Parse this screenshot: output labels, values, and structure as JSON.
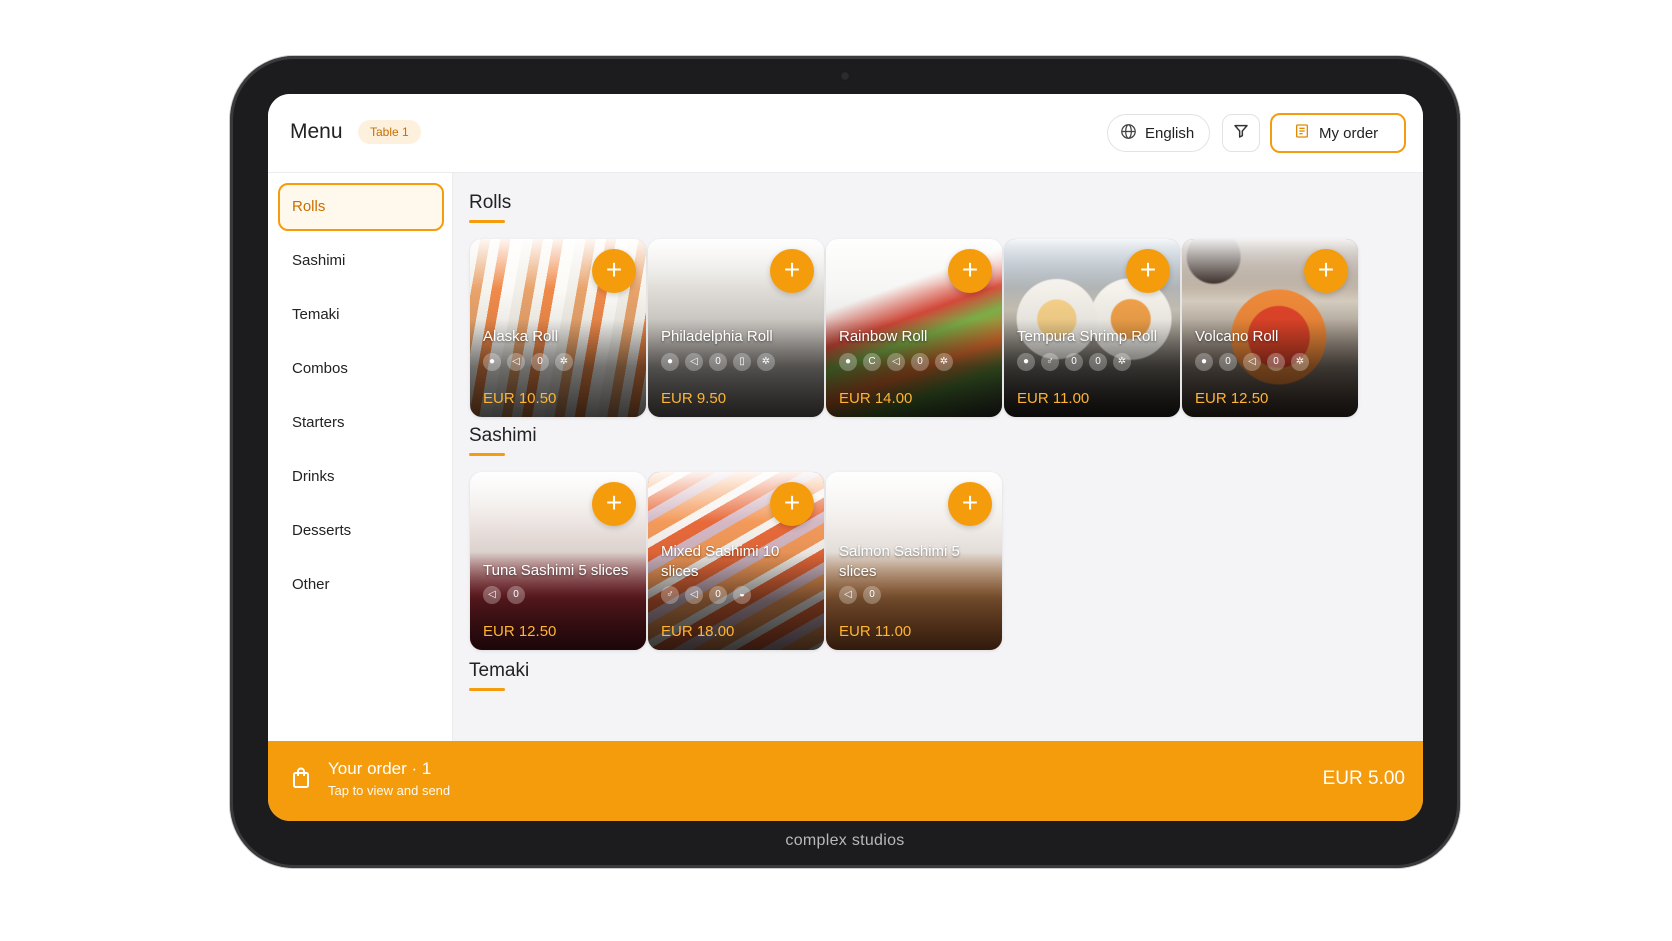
{
  "header": {
    "title": "Menu",
    "table_badge": "Table 1",
    "language": "English",
    "my_order": "My order"
  },
  "sidebar": {
    "items": [
      {
        "label": "Rolls",
        "active": true
      },
      {
        "label": "Sashimi"
      },
      {
        "label": "Temaki"
      },
      {
        "label": "Combos"
      },
      {
        "label": "Starters"
      },
      {
        "label": "Drinks"
      },
      {
        "label": "Desserts"
      },
      {
        "label": "Other"
      }
    ]
  },
  "sections": [
    {
      "title": "Rolls",
      "items": [
        {
          "name": "Alaska Roll",
          "price": "EUR 10.50",
          "tags": 4
        },
        {
          "name": "Philadelphia Roll",
          "price": "EUR 9.50",
          "tags": 5
        },
        {
          "name": "Rainbow Roll",
          "price": "EUR 14.00",
          "tags": 5
        },
        {
          "name": "Tempura Shrimp Roll",
          "price": "EUR 11.00",
          "tags": 5
        },
        {
          "name": "Volcano Roll",
          "price": "EUR 12.50",
          "tags": 5
        }
      ]
    },
    {
      "title": "Sashimi",
      "items": [
        {
          "name": "Tuna Sashimi 5 slices",
          "price": "EUR 12.50",
          "tags": 2
        },
        {
          "name": "Mixed Sashimi 10 slices",
          "price": "EUR 18.00",
          "tags": 4
        },
        {
          "name": "Salmon Sashimi 5 slices",
          "price": "EUR 11.00",
          "tags": 2
        }
      ]
    },
    {
      "title": "Temaki",
      "items": []
    }
  ],
  "order_bar": {
    "title": "Your order · 1",
    "subtitle": "Tap to view and send",
    "total": "EUR 5.00"
  },
  "device_brand": "complex studios",
  "colors": {
    "accent": "#f59c0d",
    "price": "#ffb433"
  },
  "icons": [
    "globe-icon",
    "filter-icon",
    "receipt-icon",
    "shopping-bag-icon",
    "plus-icon"
  ]
}
